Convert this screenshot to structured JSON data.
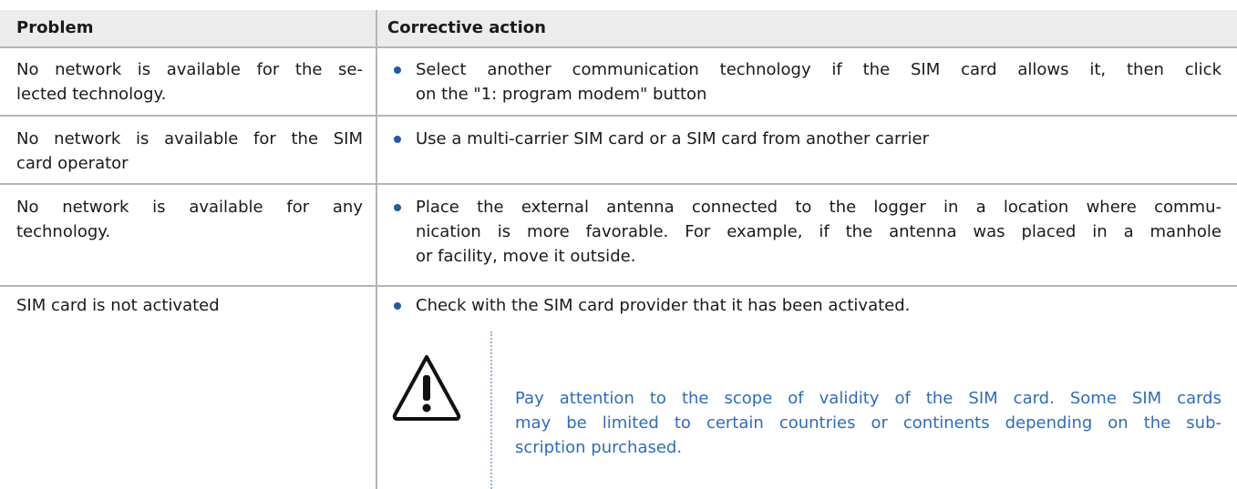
{
  "header": {
    "problem_label": "Problem",
    "action_label": "Corrective action"
  },
  "rows": [
    {
      "problem_lines": [
        "No network is available for the se-",
        "lected technology."
      ],
      "action_lines": [
        "Select another communication technology if the SIM card allows it, then click",
        "on the \"1: program modem\" button"
      ]
    },
    {
      "problem_lines": [
        "No network is available for the SIM",
        "card operator"
      ],
      "action_lines": [
        "Use a multi-carrier SIM card or a SIM card from another carrier"
      ]
    },
    {
      "problem_lines": [
        "No network is available for any",
        "technology."
      ],
      "action_lines": [
        "Place the external antenna connected to the logger in a location where commu-",
        "nication is more favorable. For example, if the antenna was placed in a manhole",
        "or facility, move it outside."
      ]
    },
    {
      "problem_lines": [
        "SIM card is not activated"
      ],
      "action_lines": [
        "Check with the SIM card provider that it has been activated."
      ]
    }
  ],
  "note": {
    "icon": "warning-triangle-icon",
    "lines": [
      "Pay attention to the scope of validity of the SIM card. Some SIM cards",
      "may be limited to certain countries or continents depending on the sub-",
      "scription purchased."
    ],
    "color": "#2d6cc0"
  },
  "colors": {
    "header_bg": "#ececec",
    "rule": "#b5b5b5",
    "bullet": "#1f5aa6"
  }
}
